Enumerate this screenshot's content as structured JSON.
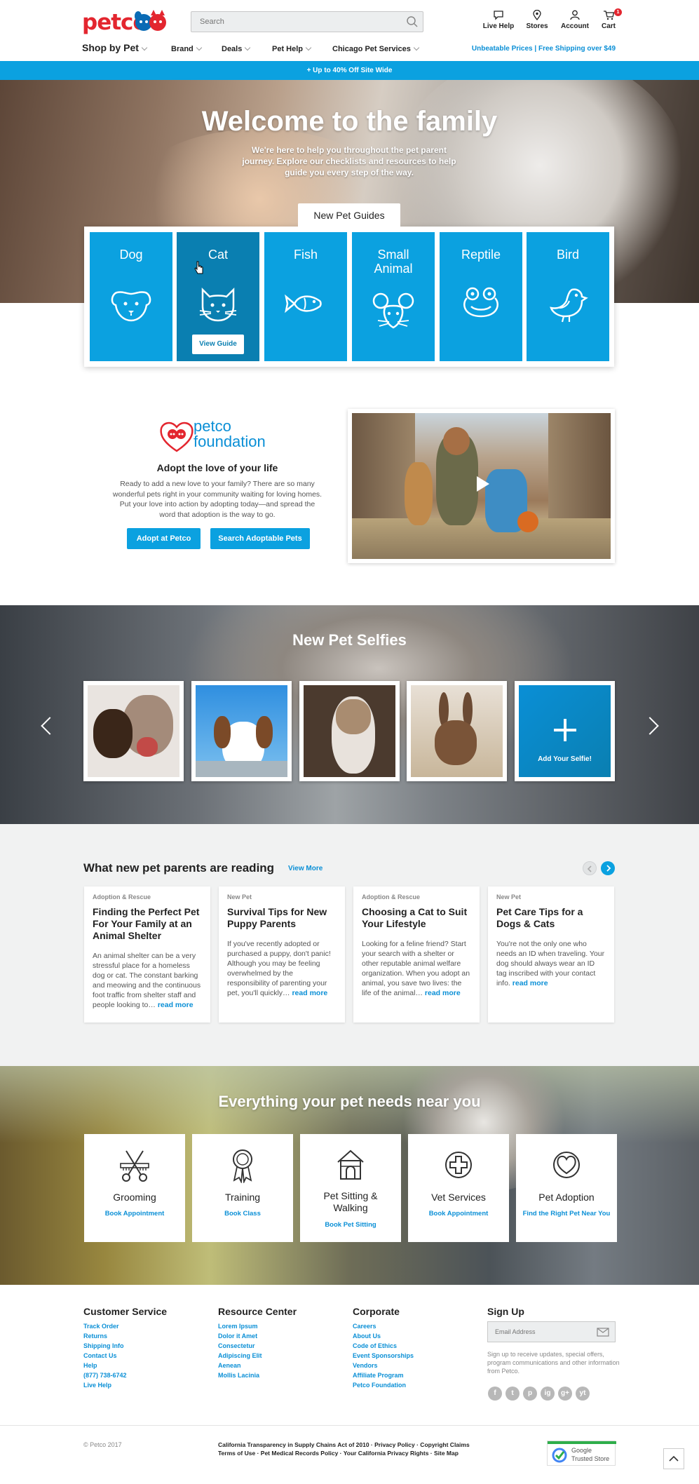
{
  "header": {
    "logo": "petco",
    "search_placeholder": "Search",
    "icons": [
      {
        "label": "Live Help",
        "icon": "chat-icon"
      },
      {
        "label": "Stores",
        "icon": "location-icon"
      },
      {
        "label": "Account",
        "icon": "user-icon"
      },
      {
        "label": "Cart",
        "icon": "cart-icon",
        "badge": "1"
      }
    ]
  },
  "nav": {
    "shop": "Shop by Pet",
    "items": [
      "Brand",
      "Deals",
      "Pet Help",
      "Chicago Pet Services"
    ],
    "promo_right": "Unbeatable Prices | Free Shipping over $49"
  },
  "promo_bar": "+  Up to 40% Off Site Wide",
  "hero": {
    "title": "Welcome to the family",
    "subtitle": "We're here to help you throughout the pet parent journey. Explore our checklists and resources to help guide you every step of the way."
  },
  "guides": {
    "tab": "New Pet Guides",
    "items": [
      "Dog",
      "Cat",
      "Fish",
      "Small Animal",
      "Reptile",
      "Bird"
    ],
    "active": "Cat",
    "button": "View Guide"
  },
  "foundation": {
    "logo_top": "petco",
    "logo_bottom": "foundation",
    "heading": "Adopt the love of your life",
    "text": "Ready to add a new love to your family? There are so many wonderful pets right in your community waiting for loving homes. Put your love into action by adopting today—and spread the word that adoption is the way to go.",
    "btn_adopt": "Adopt at Petco",
    "btn_search": "Search Adoptable Pets"
  },
  "selfies": {
    "title": "New Pet Selfies",
    "add_label": "Add Your Selfie!"
  },
  "reading": {
    "heading": "What new pet parents are reading",
    "view_more": "View More",
    "read_more": "read more",
    "cards": [
      {
        "category": "Adoption & Rescue",
        "title": "Finding the Perfect Pet For Your Family at an Animal Shelter",
        "body": "An animal shelter can be a very stressful place for a homeless dog or cat. The constant barking and meowing and the continuous foot traffic from shelter staff and people looking to…"
      },
      {
        "category": "New Pet",
        "title": "Survival Tips for New Puppy Parents",
        "body": "If you've recently adopted or purchased a puppy, don't panic! Although you may be feeling overwhelmed by the responsibility of parenting your pet, you'll quickly…"
      },
      {
        "category": "Adoption & Rescue",
        "title": "Choosing a Cat to Suit Your Lifestyle",
        "body": "Looking for a feline friend? Start your search with a shelter or other reputable animal welfare organization. When you adopt an animal, you save two lives: the life of the animal…"
      },
      {
        "category": "New Pet",
        "title": "Pet Care Tips for a Dogs & Cats",
        "body": "You're not the only one who needs an ID when traveling. Your dog should always wear an ID tag inscribed with your contact info."
      }
    ]
  },
  "services": {
    "title": "Everything your pet needs near you",
    "items": [
      {
        "name": "Grooming",
        "link": "Book Appointment"
      },
      {
        "name": "Training",
        "link": "Book Class"
      },
      {
        "name": "Pet Sitting & Walking",
        "link": "Book Pet Sitting"
      },
      {
        "name": "Vet Services",
        "link": "Book Appointment"
      },
      {
        "name": "Pet Adoption",
        "link": "Find the Right Pet Near You"
      }
    ]
  },
  "footer": {
    "columns": [
      {
        "heading": "Customer Service",
        "links": [
          "Track Order",
          "Returns",
          "Shipping Info",
          "Contact Us",
          "Help",
          "(877) 738-6742",
          "Live Help"
        ]
      },
      {
        "heading": "Resource Center",
        "links": [
          "Lorem Ipsum",
          "Dolor it Amet",
          "Consectetur",
          "Adipiscing Elit",
          "Aenean",
          "Mollis Lacinia"
        ]
      },
      {
        "heading": "Corporate",
        "links": [
          "Careers",
          "About Us",
          "Code of Ethics",
          "Event Sponsorships",
          "Vendors",
          "Affiliate Program",
          "Petco Foundation"
        ]
      }
    ],
    "signup_heading": "Sign Up",
    "email_placeholder": "Email Address",
    "signup_text": "Sign up to receive updates, special offers, program communications and other information from Petco.",
    "social": [
      "f",
      "t",
      "p",
      "ig",
      "g+",
      "yt"
    ],
    "copyright": "© Petco 2017",
    "legal_line1": "California Transparency in Supply Chains Act of 2010 · Privacy Policy · Copyright Claims",
    "legal_line2": "Terms of Use · Pet Medical Records Policy · Your California Privacy Rights · Site Map",
    "trusted_line1": "Google",
    "trusted_line2": "Trusted Store"
  },
  "colors": {
    "brand_red": "#e3262f",
    "accent_blue": "#0ba1e0",
    "active_blue": "#0a7fb1"
  }
}
